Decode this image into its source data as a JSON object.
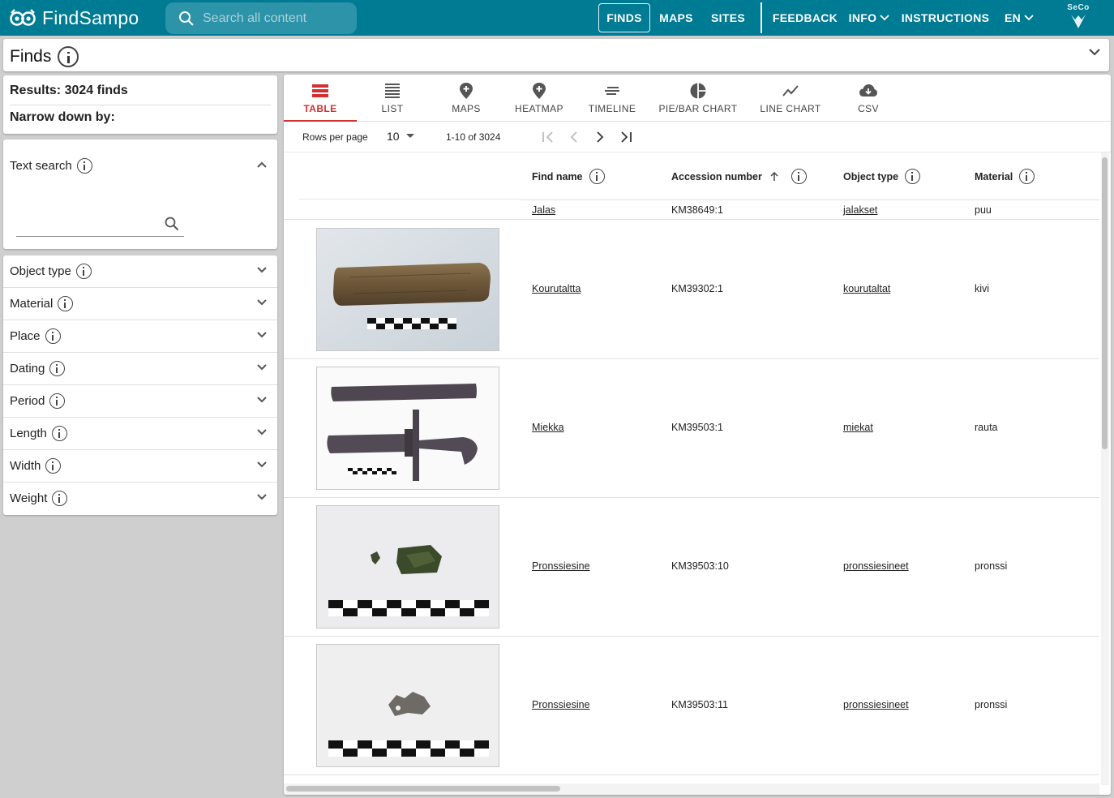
{
  "appbar": {
    "brand": "FindSampo",
    "search_placeholder": "Search all content",
    "nav": [
      "FINDS",
      "MAPS",
      "SITES",
      "FEEDBACK",
      "INFO",
      "INSTRUCTIONS",
      "EN"
    ],
    "seco": "SeCo"
  },
  "page": {
    "title": "Finds"
  },
  "results": {
    "title": "Results: 3024 finds",
    "narrow": "Narrow down by:"
  },
  "text_search": {
    "label": "Text search"
  },
  "facets": [
    "Object type",
    "Material",
    "Place",
    "Dating",
    "Period",
    "Length",
    "Width",
    "Weight"
  ],
  "tabs": [
    "TABLE",
    "LIST",
    "MAPS",
    "HEATMAP",
    "TIMELINE",
    "PIE/BAR CHART",
    "LINE CHART",
    "CSV"
  ],
  "pager": {
    "rows_label": "Rows per page",
    "rows_value": "10",
    "range": "1-10 of 3024"
  },
  "table": {
    "columns": [
      "Find name",
      "Accession number",
      "Object type",
      "Material"
    ],
    "rows": [
      {
        "name": "Jalas",
        "accession": "KM38649:1",
        "type": "jalakset",
        "material": "puu"
      },
      {
        "name": "Kourutaltta",
        "accession": "KM39302:1",
        "type": "kourutaltat",
        "material": "kivi"
      },
      {
        "name": "Miekka",
        "accession": "KM39503:1",
        "type": "miekat",
        "material": "rauta"
      },
      {
        "name": "Pronssiesine",
        "accession": "KM39503:10",
        "type": "pronssiesineet",
        "material": "pronssi"
      },
      {
        "name": "Pronssiesine",
        "accession": "KM39503:11",
        "type": "pronssiesineet",
        "material": "pronssi"
      }
    ]
  },
  "colors": {
    "appbar": "#007b94",
    "accent": "#d32f2f",
    "search_bg": "#2c93a8"
  }
}
